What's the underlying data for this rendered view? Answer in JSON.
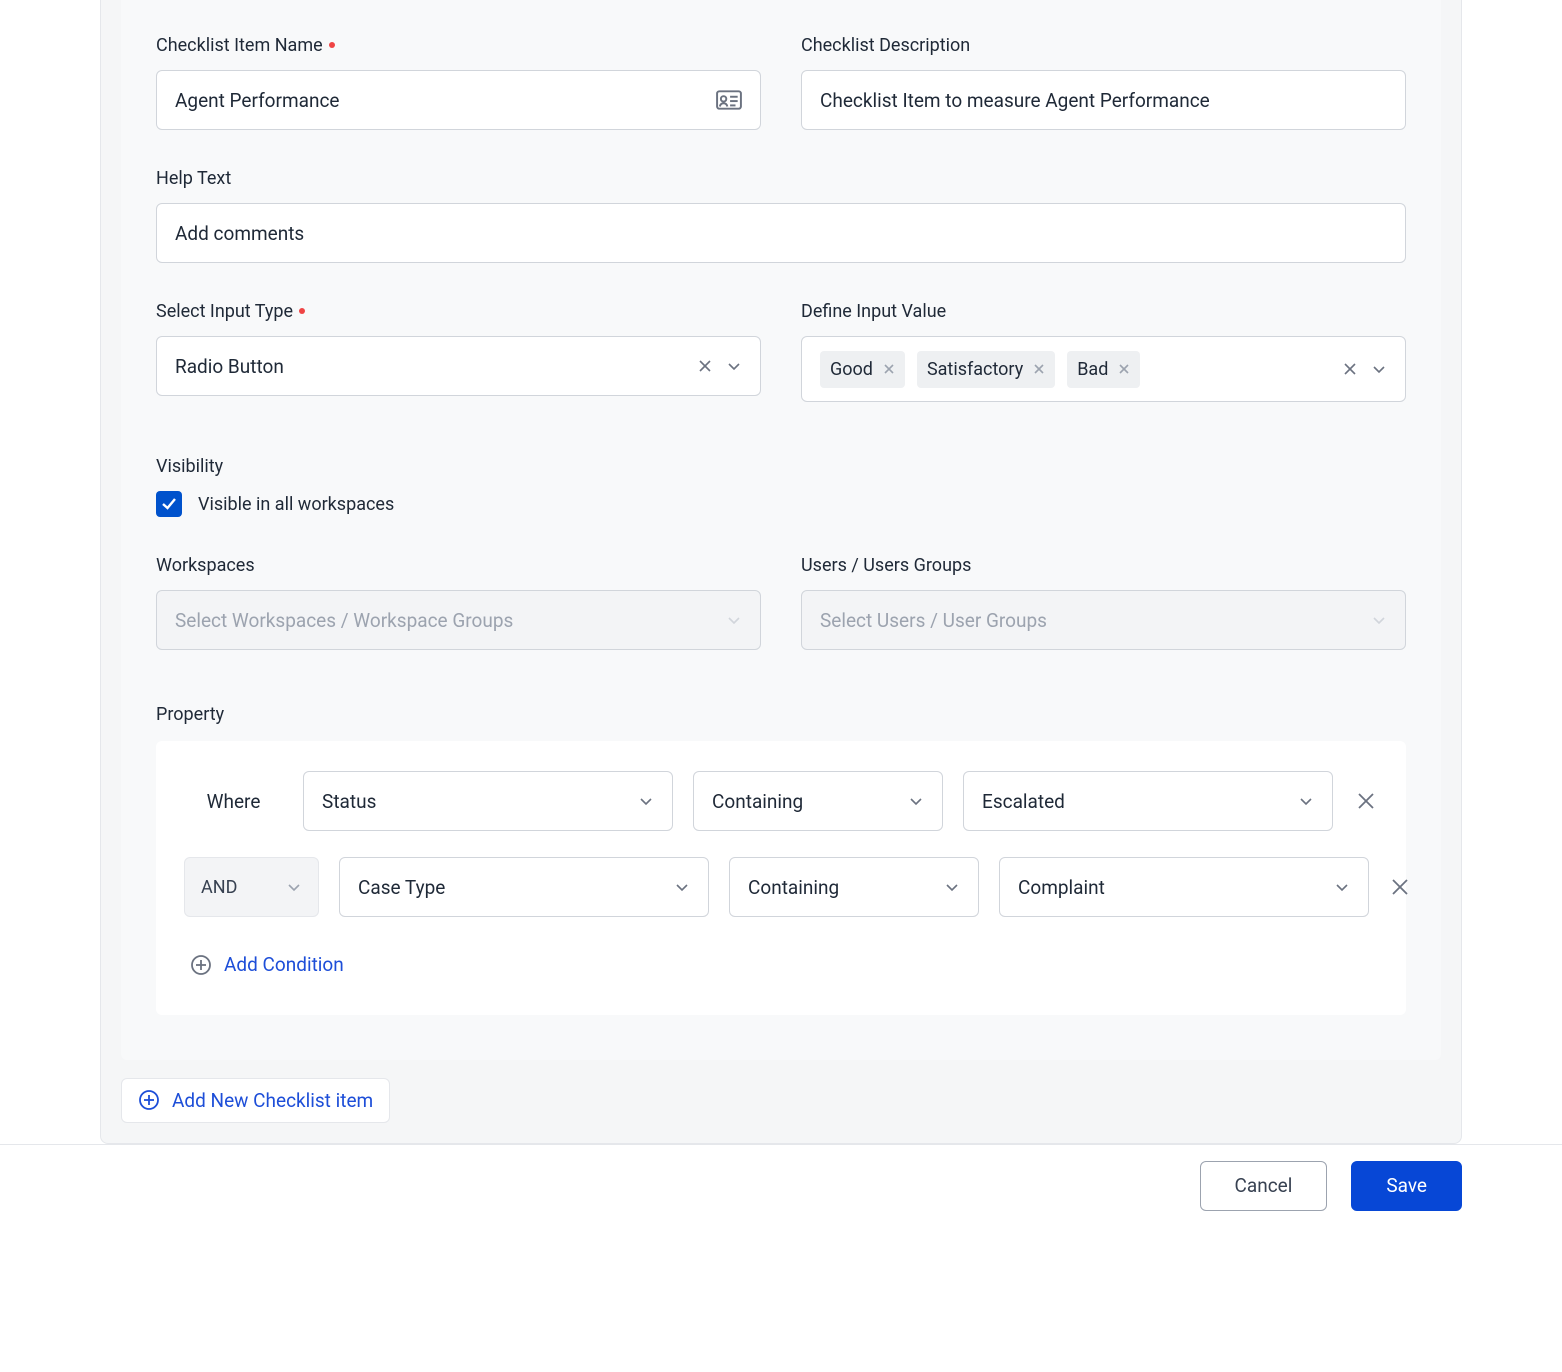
{
  "item_name": {
    "label": "Checklist Item Name",
    "value": "Agent Performance",
    "required": true
  },
  "description": {
    "label": "Checklist Description",
    "value": "Checklist Item to measure Agent Performance"
  },
  "help_text": {
    "label": "Help Text",
    "value": "Add comments"
  },
  "input_type": {
    "label": "Select Input Type",
    "value": "Radio Button",
    "required": true
  },
  "input_value": {
    "label": "Define Input Value",
    "chips": [
      "Good",
      "Satisfactory",
      "Bad"
    ]
  },
  "visibility": {
    "label": "Visibility",
    "checkbox_label": "Visible in all workspaces",
    "checked": true
  },
  "workspaces": {
    "label": "Workspaces",
    "placeholder": "Select Workspaces / Workspace Groups"
  },
  "users": {
    "label": "Users / Users Groups",
    "placeholder": "Select Users / User Groups"
  },
  "property": {
    "label": "Property",
    "where_label": "Where",
    "and_label": "AND",
    "rows": [
      {
        "field": "Status",
        "operator": "Containing",
        "value": "Escalated"
      },
      {
        "field": "Case Type",
        "operator": "Containing",
        "value": "Complaint"
      }
    ],
    "add_condition_label": "Add Condition"
  },
  "add_new_item_label": "Add New Checklist item",
  "footer": {
    "cancel": "Cancel",
    "save": "Save"
  }
}
